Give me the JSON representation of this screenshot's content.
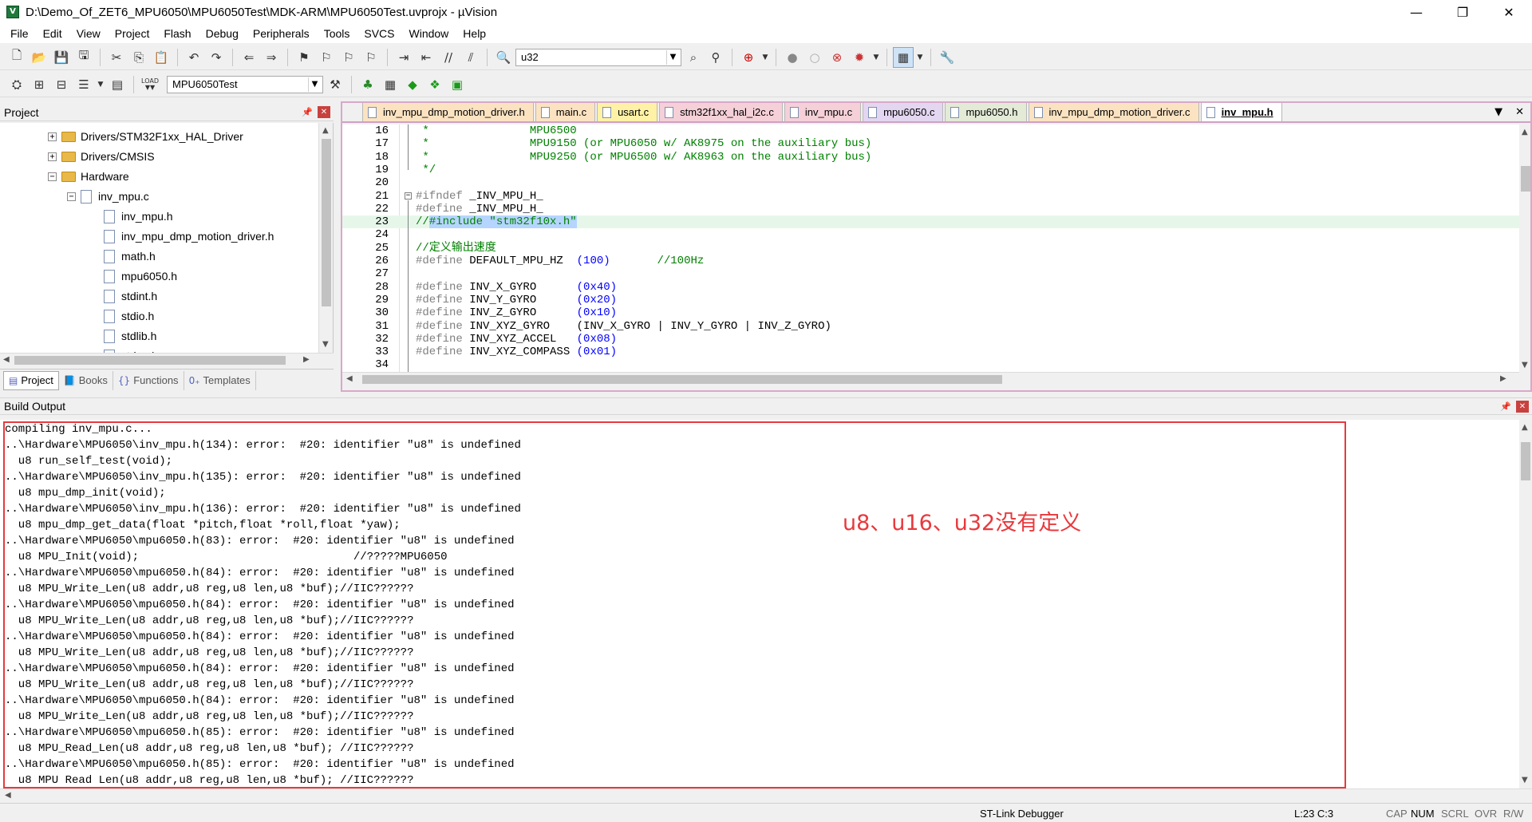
{
  "window": {
    "title": "D:\\Demo_Of_ZET6_MPU6050\\MPU6050Test\\MDK-ARM\\MPU6050Test.uvprojx - µVision",
    "controls": {
      "minimize": "—",
      "restore": "❐",
      "close": "✕"
    }
  },
  "menu": [
    "File",
    "Edit",
    "View",
    "Project",
    "Flash",
    "Debug",
    "Peripherals",
    "Tools",
    "SVCS",
    "Window",
    "Help"
  ],
  "toolbar": {
    "search_combo": "u32",
    "target_combo": "MPU6050Test",
    "load_label": "LOAD"
  },
  "project_panel": {
    "title": "Project",
    "tree": [
      {
        "label": "Drivers/STM32F1xx_HAL_Driver",
        "type": "folder",
        "expander": "+"
      },
      {
        "label": "Drivers/CMSIS",
        "type": "folder",
        "expander": "+"
      },
      {
        "label": "Hardware",
        "type": "folder",
        "expander": "−"
      },
      {
        "label": "inv_mpu.c",
        "type": "file",
        "expander": "−"
      },
      {
        "label": "inv_mpu.h",
        "type": "file"
      },
      {
        "label": "inv_mpu_dmp_motion_driver.h",
        "type": "file"
      },
      {
        "label": "math.h",
        "type": "file"
      },
      {
        "label": "mpu6050.h",
        "type": "file"
      },
      {
        "label": "stdint.h",
        "type": "file"
      },
      {
        "label": "stdio.h",
        "type": "file"
      },
      {
        "label": "stdlib.h",
        "type": "file"
      },
      {
        "label": "string.h",
        "type": "file"
      }
    ],
    "tabs": [
      "Project",
      "Books",
      "Functions",
      "Templates"
    ]
  },
  "editor": {
    "tabs": [
      {
        "label": "inv_mpu_dmp_motion_driver.h",
        "color": "#fbe3c2",
        "active": false
      },
      {
        "label": "main.c",
        "color": "#fbe3c2",
        "active": false
      },
      {
        "label": "usart.c",
        "color": "#fff2a6",
        "active": false
      },
      {
        "label": "stm32f1xx_hal_i2c.c",
        "color": "#f5d0d8",
        "active": false
      },
      {
        "label": "inv_mpu.c",
        "color": "#f5d0d8",
        "active": false
      },
      {
        "label": "mpu6050.c",
        "color": "#e3d6f0",
        "active": false
      },
      {
        "label": "mpu6050.h",
        "color": "#e3ead6",
        "active": false
      },
      {
        "label": "inv_mpu_dmp_motion_driver.c",
        "color": "#fbe3c2",
        "active": false
      },
      {
        "label": "inv_mpu.h",
        "color": "#ffffff",
        "active": true
      }
    ],
    "tab_controls": {
      "dropdown": "▼",
      "close": "✕"
    },
    "lines": [
      {
        "n": "16",
        "parts": [
          {
            "t": " *               MPU6500",
            "c": "#008000"
          }
        ]
      },
      {
        "n": "17",
        "parts": [
          {
            "t": " *               MPU9150 (or MPU6050 w/ AK8975 on the auxiliary bus)",
            "c": "#008000"
          }
        ]
      },
      {
        "n": "18",
        "parts": [
          {
            "t": " *               MPU9250 (or MPU6500 w/ AK8963 on the auxiliary bus)",
            "c": "#008000"
          }
        ]
      },
      {
        "n": "19",
        "parts": [
          {
            "t": " */",
            "c": "#008000"
          }
        ]
      },
      {
        "n": "20",
        "parts": []
      },
      {
        "n": "21",
        "parts": [
          {
            "t": "#ifndef",
            "c": "#808080"
          },
          {
            "t": " _INV_MPU_H_",
            "c": "#000000"
          }
        ]
      },
      {
        "n": "22",
        "parts": [
          {
            "t": "#define",
            "c": "#808080"
          },
          {
            "t": " _INV_MPU_H_",
            "c": "#000000"
          }
        ]
      },
      {
        "n": "23",
        "parts": [
          {
            "t": "//",
            "c": "#008000"
          },
          {
            "t": "#include \"stm32f10x.h\"",
            "c": "#008000",
            "sel": true
          }
        ]
      },
      {
        "n": "24",
        "parts": []
      },
      {
        "n": "25",
        "parts": [
          {
            "t": "//定义输出速度",
            "c": "#008000"
          }
        ]
      },
      {
        "n": "26",
        "parts": [
          {
            "t": "#define",
            "c": "#808080"
          },
          {
            "t": " DEFAULT_MPU_HZ  ",
            "c": "#000000"
          },
          {
            "t": "(100)",
            "c": "#0000ff"
          },
          {
            "t": "       ",
            "c": "#000000"
          },
          {
            "t": "//100Hz",
            "c": "#008000"
          }
        ]
      },
      {
        "n": "27",
        "parts": []
      },
      {
        "n": "28",
        "parts": [
          {
            "t": "#define",
            "c": "#808080"
          },
          {
            "t": " INV_X_GYRO      ",
            "c": "#000000"
          },
          {
            "t": "(0x40)",
            "c": "#0000ff"
          }
        ]
      },
      {
        "n": "29",
        "parts": [
          {
            "t": "#define",
            "c": "#808080"
          },
          {
            "t": " INV_Y_GYRO      ",
            "c": "#000000"
          },
          {
            "t": "(0x20)",
            "c": "#0000ff"
          }
        ]
      },
      {
        "n": "30",
        "parts": [
          {
            "t": "#define",
            "c": "#808080"
          },
          {
            "t": " INV_Z_GYRO      ",
            "c": "#000000"
          },
          {
            "t": "(0x10)",
            "c": "#0000ff"
          }
        ]
      },
      {
        "n": "31",
        "parts": [
          {
            "t": "#define",
            "c": "#808080"
          },
          {
            "t": " INV_XYZ_GYRO    (INV_X_GYRO | INV_Y_GYRO | INV_Z_GYRO)",
            "c": "#000000"
          }
        ]
      },
      {
        "n": "32",
        "parts": [
          {
            "t": "#define",
            "c": "#808080"
          },
          {
            "t": " INV_XYZ_ACCEL   ",
            "c": "#000000"
          },
          {
            "t": "(0x08)",
            "c": "#0000ff"
          }
        ]
      },
      {
        "n": "33",
        "parts": [
          {
            "t": "#define",
            "c": "#808080"
          },
          {
            "t": " INV_XYZ_COMPASS ",
            "c": "#000000"
          },
          {
            "t": "(0x01)",
            "c": "#0000ff"
          }
        ]
      },
      {
        "n": "34",
        "parts": []
      }
    ]
  },
  "build_output": {
    "title": "Build Output",
    "lines": [
      "compiling inv_mpu.c...",
      "..\\Hardware\\MPU6050\\inv_mpu.h(134): error:  #20: identifier \"u8\" is undefined",
      "  u8 run_self_test(void);",
      "..\\Hardware\\MPU6050\\inv_mpu.h(135): error:  #20: identifier \"u8\" is undefined",
      "  u8 mpu_dmp_init(void);",
      "..\\Hardware\\MPU6050\\inv_mpu.h(136): error:  #20: identifier \"u8\" is undefined",
      "  u8 mpu_dmp_get_data(float *pitch,float *roll,float *yaw);",
      "..\\Hardware\\MPU6050\\mpu6050.h(83): error:  #20: identifier \"u8\" is undefined",
      "  u8 MPU_Init(void);                                //?????MPU6050",
      "..\\Hardware\\MPU6050\\mpu6050.h(84): error:  #20: identifier \"u8\" is undefined",
      "  u8 MPU_Write_Len(u8 addr,u8 reg,u8 len,u8 *buf);//IIC??????",
      "..\\Hardware\\MPU6050\\mpu6050.h(84): error:  #20: identifier \"u8\" is undefined",
      "  u8 MPU_Write_Len(u8 addr,u8 reg,u8 len,u8 *buf);//IIC??????",
      "..\\Hardware\\MPU6050\\mpu6050.h(84): error:  #20: identifier \"u8\" is undefined",
      "  u8 MPU_Write_Len(u8 addr,u8 reg,u8 len,u8 *buf);//IIC??????",
      "..\\Hardware\\MPU6050\\mpu6050.h(84): error:  #20: identifier \"u8\" is undefined",
      "  u8 MPU_Write_Len(u8 addr,u8 reg,u8 len,u8 *buf);//IIC??????",
      "..\\Hardware\\MPU6050\\mpu6050.h(84): error:  #20: identifier \"u8\" is undefined",
      "  u8 MPU_Write_Len(u8 addr,u8 reg,u8 len,u8 *buf);//IIC??????",
      "..\\Hardware\\MPU6050\\mpu6050.h(85): error:  #20: identifier \"u8\" is undefined",
      "  u8 MPU_Read_Len(u8 addr,u8 reg,u8 len,u8 *buf); //IIC??????",
      "..\\Hardware\\MPU6050\\mpu6050.h(85): error:  #20: identifier \"u8\" is undefined",
      "  u8 MPU Read Len(u8 addr,u8 reg,u8 len,u8 *buf); //IIC??????"
    ],
    "annotation": "u8、u16、u32没有定义",
    "annotation_color": "#e8393d"
  },
  "status": {
    "debugger": "ST-Link Debugger",
    "position": "L:23 C:3",
    "flags": [
      "CAP",
      "NUM",
      "SCRL",
      "OVR",
      "R/W"
    ]
  }
}
